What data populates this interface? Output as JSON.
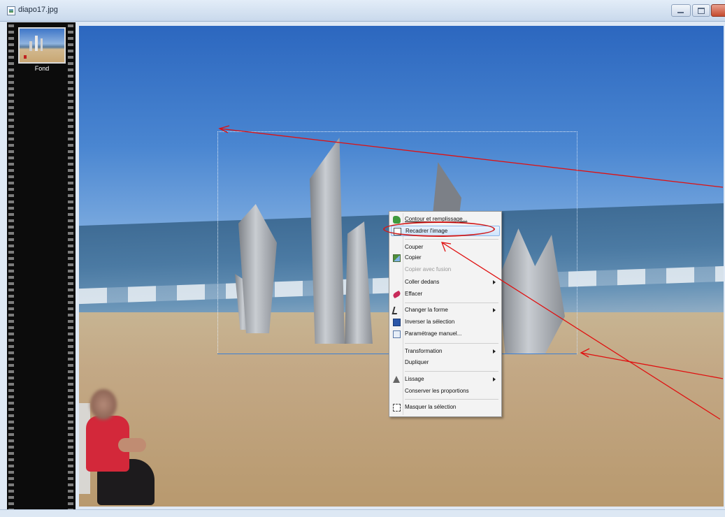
{
  "window": {
    "title": "diapo17.jpg"
  },
  "filmstrip": {
    "items": [
      {
        "label": "Fond"
      }
    ]
  },
  "context_menu": {
    "items": [
      {
        "label": "Contour et remplissage...",
        "icon": "contour-icon",
        "state": "underlined"
      },
      {
        "label": "Recadrer l'image",
        "icon": "crop-icon",
        "state": "highlighted"
      },
      {
        "label": "Couper"
      },
      {
        "label": "Copier",
        "icon": "copy-icon"
      },
      {
        "label": "Copier avec fusion",
        "state": "disabled"
      },
      {
        "label": "Coller dedans",
        "submenu": true
      },
      {
        "label": "Effacer",
        "icon": "eraser-icon"
      },
      {
        "label": "Changer la forme",
        "icon": "shape-icon",
        "submenu": true
      },
      {
        "label": "Inverser la sélection",
        "icon": "invert-selection-icon"
      },
      {
        "label": "Paramétrage manuel...",
        "icon": "manual-settings-icon"
      },
      {
        "label": "Transformation",
        "submenu": true
      },
      {
        "label": "Dupliquer"
      },
      {
        "label": "Lissage",
        "icon": "smoothing-icon",
        "submenu": true
      },
      {
        "label": "Conserver les proportions"
      },
      {
        "label": "Masquer la sélection",
        "icon": "hide-selection-icon"
      }
    ]
  },
  "colors": {
    "annotation": "#e01010",
    "highlight_ellipse": "#d11a1a",
    "selection_edge": "#3d7fd3",
    "menu_highlight": "#cfe4fb"
  }
}
